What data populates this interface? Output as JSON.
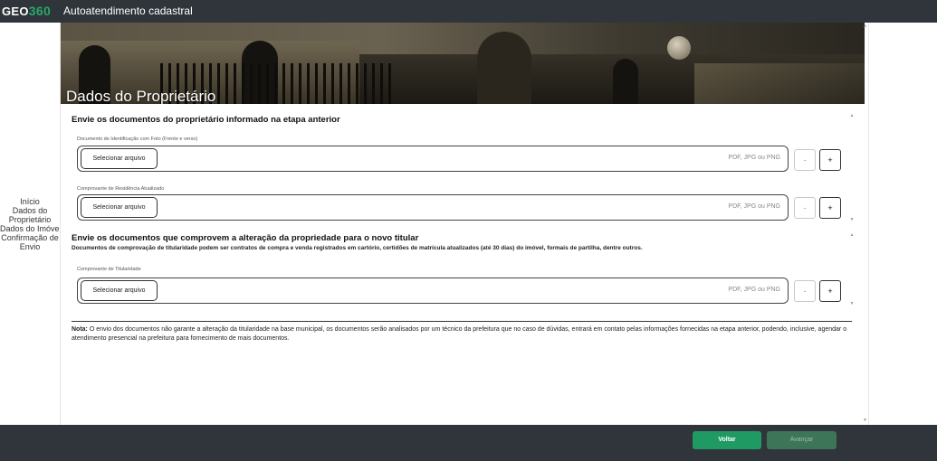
{
  "header": {
    "logo_text": "GEO",
    "logo_num": "360",
    "title": "Autoatendimento cadastral"
  },
  "sidebar": {
    "items": [
      {
        "label": "Início"
      },
      {
        "label": "Dados do"
      },
      {
        "label": "Proprietário"
      },
      {
        "label": "Dados do Imóvel"
      },
      {
        "label": "Confirmação de"
      },
      {
        "label": "Envio"
      }
    ]
  },
  "banner": {
    "title": "Dados do Proprietário"
  },
  "section1": {
    "title": "Envie os documentos do proprietário informado na etapa anterior",
    "fields": [
      {
        "label": "Documento de Identificação com Foto (Frente e verso)",
        "button": "Selecionar arquivo",
        "hint": "PDF, JPG ou PNG",
        "minus": "-",
        "plus": "+"
      },
      {
        "label": "Comprovante de Residência Atualizado",
        "button": "Selecionar arquivo",
        "hint": "PDF, JPG ou PNG",
        "minus": "-",
        "plus": "+"
      }
    ]
  },
  "section2": {
    "title": "Envie os documentos que comprovem a alteração da propriedade para o novo titular",
    "description": "Documentos de comprovação de titularidade podem ser contratos de compra e venda registrados em cartório, certidões de matrícula atualizados (até 30 dias) do imóvel, formais de partilha, dentre outros.",
    "fields": [
      {
        "label": "Comprovante de Titularidade",
        "button": "Selecionar arquivo",
        "hint": "PDF, JPG ou PNG",
        "minus": "-",
        "plus": "+"
      }
    ]
  },
  "note": {
    "label": "Nota:",
    "text": " O envio dos documentos não garante a alteração da titularidade na base municipal, os documentos serão analisados por um técnico da prefeitura que no caso de dúvidas, entrará em contato pelas informações fornecidas na etapa anterior, podendo, inclusive, agendar o atendimento presencial na prefeitura para fornecimento de mais documentos."
  },
  "footer": {
    "back_label": "Voltar",
    "next_label": "Avançar"
  },
  "colors": {
    "header_bg": "#2f353b",
    "primary_button": "#1f9a63",
    "disabled_button": "#3d7558"
  }
}
